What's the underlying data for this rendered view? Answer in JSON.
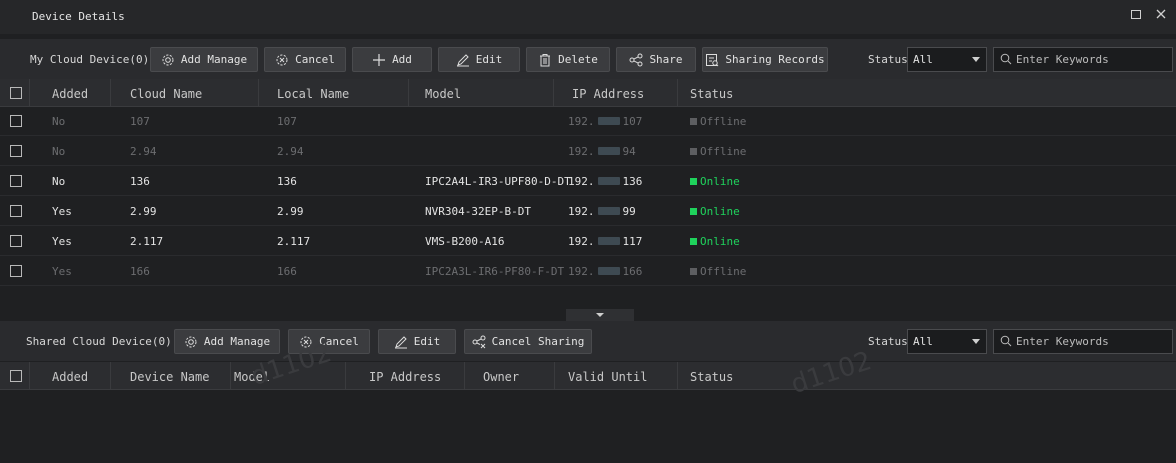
{
  "window": {
    "title": "Device Details"
  },
  "my_cloud": {
    "label": "My Cloud Device(0)",
    "buttons": {
      "add_manage": "Add Manage",
      "cancel": "Cancel",
      "add": "Add",
      "edit": "Edit",
      "delete": "Delete",
      "share": "Share",
      "sharing_records": "Sharing Records"
    },
    "status_label": "Status",
    "status_value": "All",
    "search_placeholder": "Enter Keywords",
    "columns": [
      "Added",
      "Cloud Name",
      "Local Name",
      "Model",
      "IP Address",
      "Status"
    ],
    "rows": [
      {
        "added": "No",
        "cloud_name": "107",
        "local_name": "107",
        "model": "",
        "ip_prefix": "192.",
        "ip_suffix": "107",
        "status": "Offline",
        "online": false
      },
      {
        "added": "No",
        "cloud_name": "2.94",
        "local_name": "2.94",
        "model": "",
        "ip_prefix": "192.",
        "ip_suffix": "94",
        "status": "Offline",
        "online": false
      },
      {
        "added": "No",
        "cloud_name": "136",
        "local_name": "136",
        "model": "IPC2A4L-IR3-UPF80-D-DT",
        "ip_prefix": "192.",
        "ip_suffix": "136",
        "status": "Online",
        "online": true
      },
      {
        "added": "Yes",
        "cloud_name": "2.99",
        "local_name": "2.99",
        "model": "NVR304-32EP-B-DT",
        "ip_prefix": "192.",
        "ip_suffix": "99",
        "status": "Online",
        "online": true
      },
      {
        "added": "Yes",
        "cloud_name": "2.117",
        "local_name": "2.117",
        "model": "VMS-B200-A16",
        "ip_prefix": "192.",
        "ip_suffix": "117",
        "status": "Online",
        "online": true
      },
      {
        "added": "Yes",
        "cloud_name": "166",
        "local_name": "166",
        "model": "IPC2A3L-IR6-PF80-F-DT",
        "ip_prefix": "192.",
        "ip_suffix": "166",
        "status": "Offline",
        "online": false
      }
    ]
  },
  "shared_cloud": {
    "label": "Shared Cloud Device(0)",
    "buttons": {
      "add_manage": "Add Manage",
      "cancel": "Cancel",
      "edit": "Edit",
      "cancel_sharing": "Cancel Sharing"
    },
    "status_label": "Status",
    "status_value": "All",
    "search_placeholder": "Enter Keywords",
    "columns": [
      "Added",
      "Device Name",
      "Model",
      "IP Address",
      "Owner",
      "Valid Until",
      "Status"
    ]
  },
  "watermark": [
    "d1102",
    "d1102"
  ],
  "colors": {
    "online": "#1fd25c",
    "offline": "#6c6d70",
    "background": "#1f2022"
  },
  "icons": [
    "gear-icon",
    "cancel-gear-icon",
    "plus-icon",
    "pencil-icon",
    "trash-icon",
    "share-icon",
    "records-icon",
    "search-icon",
    "maximize-icon",
    "close-icon",
    "chevron-down-icon"
  ]
}
